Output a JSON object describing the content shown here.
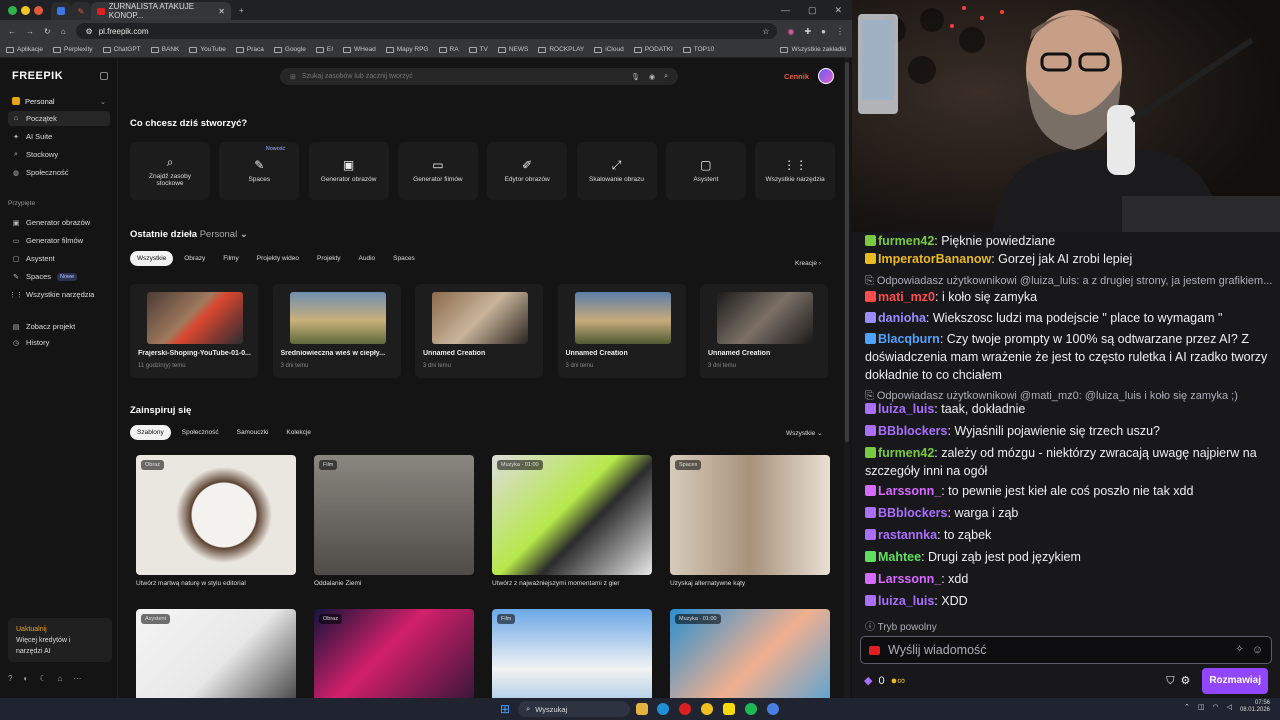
{
  "browser": {
    "tabs": [
      {
        "label": "ZURNALISTA ATAKUJE KONOP..."
      }
    ],
    "url": "pl.freepik.com",
    "bookmarks": [
      "Aplikacje",
      "Perplexity",
      "ChatGPT",
      "BANK",
      "YouTube",
      "Praca",
      "Google",
      "EI",
      "WHead",
      "Mapy RPG",
      "RA",
      "TV",
      "NEWS",
      "ROCKPLAY",
      "iCloud",
      "PODATKI",
      "TOP10",
      "Wszystkie zakładki"
    ]
  },
  "app": {
    "logo": "FREEPIK",
    "workspace": "Personal",
    "nav": [
      "Początek",
      "AI Suite",
      "Stockowy",
      "Społeczność"
    ],
    "pinned_title": "Przypięte",
    "pinned": [
      "Generator obrazów",
      "Generator filmów",
      "Asystent",
      "Spaces",
      "Wszystkie narzędzia"
    ],
    "new_badge": "Nowe",
    "extra": [
      "Zobacz projekt",
      "History"
    ],
    "upsell": {
      "title": "Uaktualnij",
      "line1": "Więcej kredytów i",
      "line2": "narzędzi AI"
    },
    "search_placeholder": "Szukaj zasobów lub zacznij tworzyć",
    "cennik": "Cennik",
    "create_title": "Co chcesz dziś stworzyć?",
    "tools": [
      {
        "icon": "⌕",
        "label": "Znajdź zasoby stockowe"
      },
      {
        "icon": "✎",
        "label": "Spaces",
        "badge": "Nowość"
      },
      {
        "icon": "▣",
        "label": "Generator obrazów"
      },
      {
        "icon": "▭",
        "label": "Generator filmów"
      },
      {
        "icon": "✐",
        "label": "Edytor obrazów"
      },
      {
        "icon": "⤢",
        "label": "Skalowanie obrazu"
      },
      {
        "icon": "▢",
        "label": "Asystent"
      },
      {
        "icon": "⋮⋮",
        "label": "Wszystkie narzędzia"
      }
    ],
    "recent_title": "Ostatnie dzieła",
    "recent_ws": "Personal",
    "recent_chips": [
      "Wszystkie",
      "Obrazy",
      "Filmy",
      "Projekty wideo",
      "Projekty",
      "Audio",
      "Spaces"
    ],
    "kreacje": "Kreacje",
    "recent": [
      {
        "title": "Frajerski-Shoping-YouTube-01-0...",
        "time": "11 godzin(y) temu"
      },
      {
        "title": "Średniowieczna wieś w ciepły...",
        "time": "3 dni temu"
      },
      {
        "title": "Unnamed Creation",
        "time": "3 dni temu"
      },
      {
        "title": "Unnamed Creation",
        "time": "3 dni temu"
      },
      {
        "title": "Unnamed Creation",
        "time": "3 dni temu"
      }
    ],
    "inspire_title": "Zainspiruj się",
    "inspire_chips": [
      "Szablony",
      "Społeczność",
      "Samouczki",
      "Kolekcje"
    ],
    "inspire_all": "Wszystkie",
    "inspire": [
      {
        "tag": "Obraz",
        "caption": "Utwórz martwą naturę w stylu editorial"
      },
      {
        "tag": "Film",
        "caption": "Oddalanie Ziemi"
      },
      {
        "tag": "Muzyka · 01:00",
        "caption": "Utwórz z najważniejszymi momentami z gier"
      },
      {
        "tag": "Spaces",
        "caption": "Uzyskaj alternatywne kąty"
      },
      {
        "tag": "Asystent",
        "caption": ""
      },
      {
        "tag": "Obraz",
        "caption": ""
      },
      {
        "tag": "Film",
        "caption": ""
      },
      {
        "tag": "Muzyka · 01:00",
        "caption": ""
      }
    ]
  },
  "chat": {
    "messages": [
      {
        "user": "furmen42",
        "color": "#7ac943",
        "text": "Pięknie powiedziane"
      },
      {
        "user": "ImperatorBananow",
        "color": "#e8b923",
        "text": "Gorzej jak AI zrobi lepiej"
      },
      {
        "reply": "Odpowiadasz użytkownikowi @luiza_luis: a z drugiej strony, ja jestem grafikiem..."
      },
      {
        "user": "mati_mz0",
        "color": "#ff4d4d",
        "text": "i koło się zamyka"
      },
      {
        "user": "danioha",
        "color": "#9b8cff",
        "text": "Wiekszosc ludzi ma podejscie \" place to wymagam \""
      },
      {
        "user": "Blacqburn",
        "color": "#4fa3ff",
        "text": "Czy twoje prompty w 100% są odtwarzane przez AI? Z doświadczenia mam wrażenie że jest to często ruletka i AI rzadko tworzy dokładnie to co chciałem"
      },
      {
        "reply": "Odpowiadasz użytkownikowi @mati_mz0: @luiza_luis i koło się zamyka ;)"
      },
      {
        "user": "luiza_luis",
        "color": "#a970ff",
        "text": "taak, dokładnie"
      },
      {
        "user": "BBblockers",
        "color": "#a970ff",
        "text": "Wyjaśnili pojawienie się trzech uszu?"
      },
      {
        "user": "furmen42",
        "color": "#7ac943",
        "text": "zależy od mózgu - niektórzy zwracają uwagę najpierw na szczegóły inni na ogół"
      },
      {
        "user": "Larssonn_",
        "color": "#d86bff",
        "text": "to pewnie jest kieł ale coś poszło nie tak xdd"
      },
      {
        "user": "BBblockers",
        "color": "#a970ff",
        "text": "warga i ząb"
      },
      {
        "user": "rastannka",
        "color": "#a970ff",
        "text": "to ząbek"
      },
      {
        "user": "Mahtee",
        "color": "#5ee05e",
        "text": "Drugi ząb jest pod językiem"
      },
      {
        "user": "Larssonn_",
        "color": "#d86bff",
        "text": "xdd"
      },
      {
        "user": "luiza_luis",
        "color": "#a970ff",
        "text": "XDD"
      }
    ],
    "slow_mode": "Tryb powolny",
    "input_placeholder": "Wyślij wiadomość",
    "points": "0",
    "send": "Rozmawiaj"
  },
  "taskbar": {
    "search": "Wyszukaj",
    "time": "07:56",
    "date": "08.01.2026"
  }
}
